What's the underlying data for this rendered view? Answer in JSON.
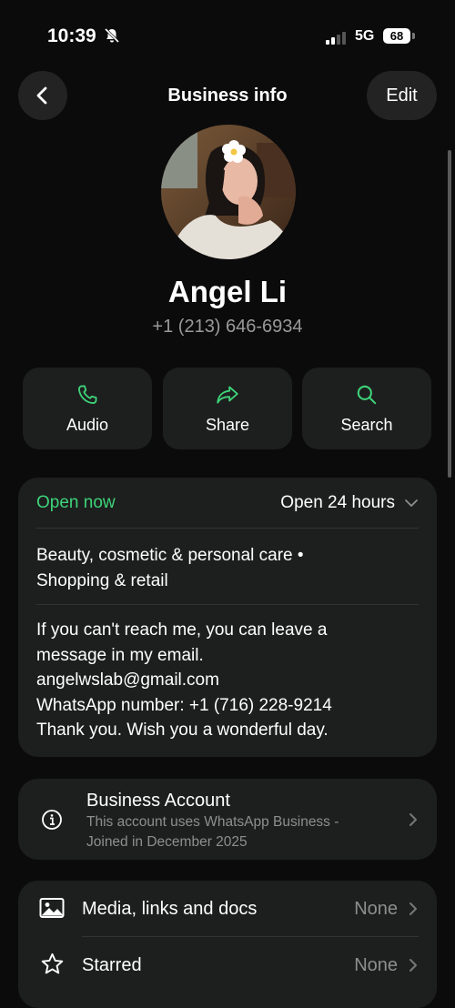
{
  "status_bar": {
    "time": "10:39",
    "network": "5G",
    "battery": "68"
  },
  "nav": {
    "title": "Business info",
    "edit_label": "Edit"
  },
  "profile": {
    "name": "Angel Li",
    "phone": "+1 (213) 646-6934"
  },
  "actions": [
    {
      "label": "Audio",
      "icon": "phone-icon"
    },
    {
      "label": "Share",
      "icon": "share-icon"
    },
    {
      "label": "Search",
      "icon": "search-icon"
    }
  ],
  "business": {
    "status": "Open now",
    "hours": "Open 24 hours",
    "category_line1": "Beauty, cosmetic & personal care •",
    "category_line2": "Shopping & retail",
    "about": [
      "If you can't reach me, you can leave a",
      "message in my email.",
      "angelwslab@gmail.com",
      "WhatsApp number:  +1 (716) 228-9214",
      "Thank you. Wish you a wonderful day."
    ]
  },
  "account": {
    "title": "Business Account",
    "subtitle_line1": "This account uses WhatsApp Business -",
    "subtitle_line2": "Joined in December 2025"
  },
  "list": [
    {
      "label": "Media, links and docs",
      "value": "None",
      "icon": "image-icon"
    },
    {
      "label": "Starred",
      "value": "None",
      "icon": "star-icon"
    }
  ],
  "colors": {
    "accent": "#3ed37a",
    "card": "#1d1f1e",
    "background": "#0b0b0b"
  }
}
